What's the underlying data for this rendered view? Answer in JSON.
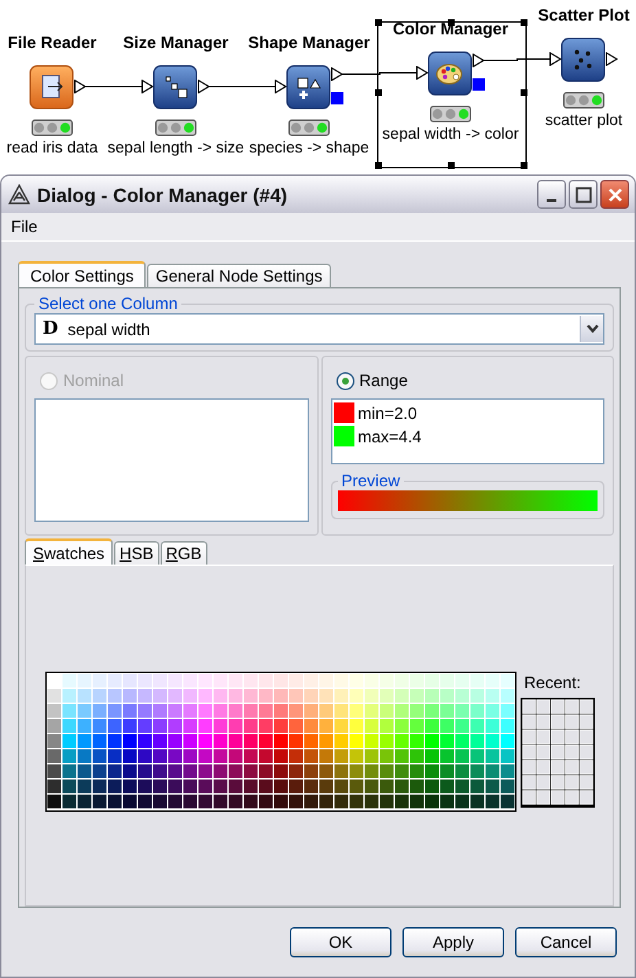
{
  "workflow": {
    "nodes": [
      {
        "title": "File Reader",
        "label": "read iris data",
        "kind": "reader",
        "executed": true,
        "model_port": false,
        "selected": false
      },
      {
        "title": "Size Manager",
        "label": "sepal length -> size",
        "kind": "size",
        "executed": true,
        "model_port": false,
        "selected": false
      },
      {
        "title": "Shape Manager",
        "label": "species -> shape",
        "kind": "shape",
        "executed": true,
        "model_port": true,
        "selected": false
      },
      {
        "title": "Color Manager",
        "label": "sepal width -> color",
        "kind": "color",
        "executed": true,
        "model_port": true,
        "selected": true
      },
      {
        "title": "Scatter Plot",
        "label": "scatter plot",
        "kind": "plot",
        "executed": true,
        "model_port": false,
        "selected": false
      }
    ]
  },
  "window": {
    "title": "Dialog - Color Manager (#4)"
  },
  "menu": [
    "File"
  ],
  "tabs": [
    {
      "label": "Color Settings",
      "selected": true
    },
    {
      "label": "General Node Settings",
      "selected": false
    }
  ],
  "column_group": {
    "title": "Select one Column",
    "type_badge": "D",
    "value": "sepal width"
  },
  "nominal": {
    "label": "Nominal",
    "selected": false,
    "disabled": true
  },
  "range": {
    "label": "Range",
    "selected": true,
    "items": [
      {
        "label": "min=2.0",
        "color": "#ff0000"
      },
      {
        "label": "max=4.4",
        "color": "#00ff00"
      }
    ],
    "preview_title": "Preview"
  },
  "color_tabs": [
    {
      "label": "Swatches",
      "selected": true
    },
    {
      "label": "HSB",
      "selected": false
    },
    {
      "label": "RGB",
      "selected": false
    }
  ],
  "recent_label": "Recent:",
  "buttons": [
    "OK",
    "Apply",
    "Cancel"
  ]
}
